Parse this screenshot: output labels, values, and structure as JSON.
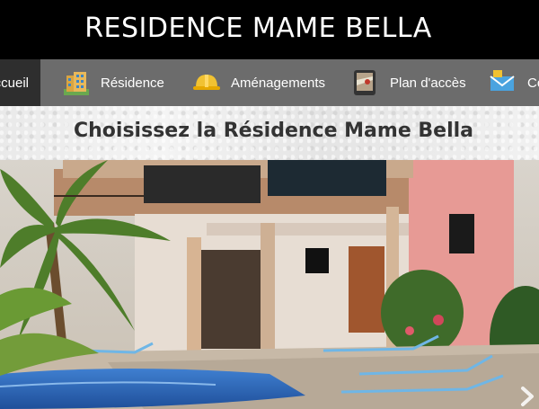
{
  "header": {
    "title": "RESIDENCE MAME BELLA"
  },
  "nav": {
    "items": [
      {
        "label": "ccueil",
        "active": true
      },
      {
        "label": "Résidence",
        "icon": "building-icon"
      },
      {
        "label": "Aménagements",
        "icon": "hard-hat-icon"
      },
      {
        "label": "Plan d'accès",
        "icon": "map-tablet-icon"
      },
      {
        "label": "Co",
        "icon": "mail-icon"
      }
    ]
  },
  "main": {
    "heading": "Choisissez la Résidence Mame Bella"
  },
  "hero": {
    "image": "residence-pool-photo",
    "next_icon": "chevron-right-icon"
  },
  "colors": {
    "header_bg": "#000000",
    "nav_bg": "#6c6c6c",
    "nav_active_bg": "#2e2e2e",
    "heading_text": "#333333"
  }
}
